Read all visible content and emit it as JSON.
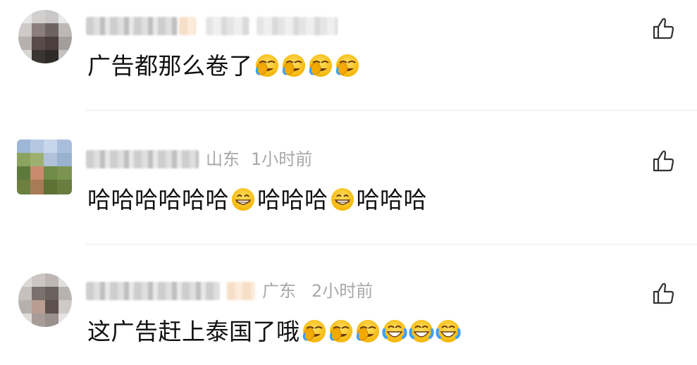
{
  "comments": [
    {
      "location": "",
      "time": "",
      "text": "广告都那么卷了",
      "emoji": [
        "face-with-tears-of-joy-hand",
        "face-with-tears-of-joy-hand",
        "face-with-tears-of-joy-hand",
        "face-with-tears-of-joy-hand"
      ]
    },
    {
      "location": "山东",
      "time": "1小时前",
      "segments": [
        {
          "type": "text",
          "value": "哈哈哈哈哈哈"
        },
        {
          "type": "emoji",
          "value": "grinning-face-icon"
        },
        {
          "type": "text",
          "value": "哈哈哈"
        },
        {
          "type": "emoji",
          "value": "grinning-face-icon"
        },
        {
          "type": "text",
          "value": "哈哈哈"
        }
      ]
    },
    {
      "location": "广东",
      "time": "2小时前",
      "text": "这广告赶上泰国了哦",
      "emoji": [
        "face-with-tears-of-joy-hand",
        "face-with-tears-of-joy-hand",
        "face-with-tears-of-joy-hand",
        "face-with-tears-of-joy",
        "face-with-tears-of-joy",
        "face-with-tears-of-joy"
      ]
    }
  ],
  "icons": {
    "like": "thumbs-up-outline-icon"
  },
  "colors": {
    "text": "#111111",
    "meta": "#a7a7a7",
    "divider": "#e7e7e7",
    "emoji": "#f7c21c"
  }
}
